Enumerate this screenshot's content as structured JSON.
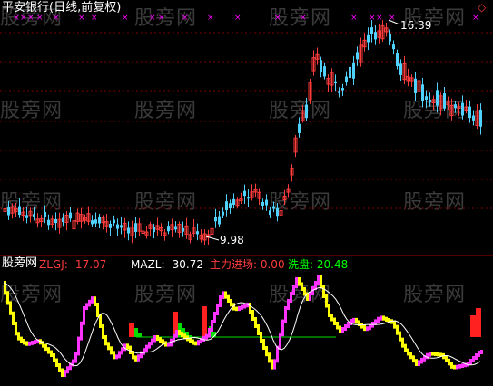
{
  "window": {
    "title": "平安银行(日线,前复权)",
    "watermark_text": "股旁网",
    "top_right_marker_icon": "hollow-diamond-icon"
  },
  "main_chart": {
    "type": "candlestick",
    "high_label": "16.39",
    "low_label": "9.98",
    "x_marker_icon": "magenta-x-icon",
    "colors": {
      "up": "#ff3c3c",
      "down": "#4fd2ff",
      "grid": "#7a0000",
      "label": "#ffffff",
      "marker": "#ff00ff"
    }
  },
  "indicator_panel": {
    "name": "股旁网",
    "fields": [
      {
        "name": "ZLGJ",
        "label": "ZLGJ: -17.07",
        "color": "#ff3c3c"
      },
      {
        "name": "MAZL",
        "label": "MAZL: -30.72",
        "color": "#ffffff"
      },
      {
        "name": "主力进场",
        "label": "主力进场: 0.00",
        "color": "#ff3c3c"
      },
      {
        "name": "洗盘",
        "label": "洗盘: 20.48",
        "color": "#00ff00"
      }
    ],
    "colors": {
      "rise": "#ff33ff",
      "fall": "#ffff00",
      "ma_line": "#ffffff",
      "entry_bar": "#ff2020",
      "wash_area": "#00dd00"
    }
  }
}
